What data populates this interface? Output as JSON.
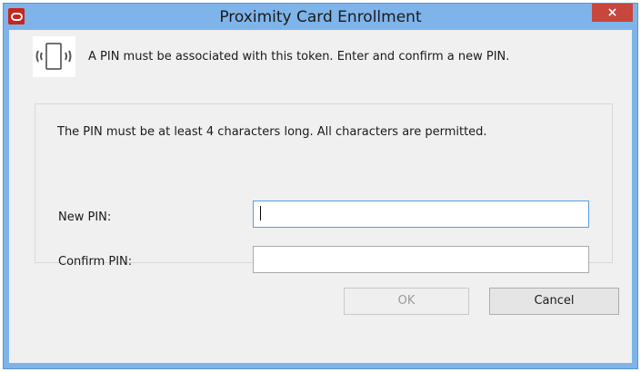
{
  "window": {
    "title": "Proximity Card Enrollment",
    "close_label": "×"
  },
  "intro": {
    "icon": "proximity-card-icon",
    "text": "A PIN must be associated with this token. Enter and confirm a new PIN."
  },
  "pin_group": {
    "hint": "The PIN must be at least 4 characters long. All characters are permitted.",
    "new_pin_label": "New PIN:",
    "new_pin_value": "",
    "confirm_pin_label": "Confirm PIN:",
    "confirm_pin_value": ""
  },
  "buttons": {
    "ok": "OK",
    "ok_enabled": false,
    "cancel": "Cancel"
  },
  "colors": {
    "title_bar": "#7eb4ea",
    "close_button": "#c7463d",
    "app_icon": "#c8251b",
    "focus_border": "#569de5"
  }
}
